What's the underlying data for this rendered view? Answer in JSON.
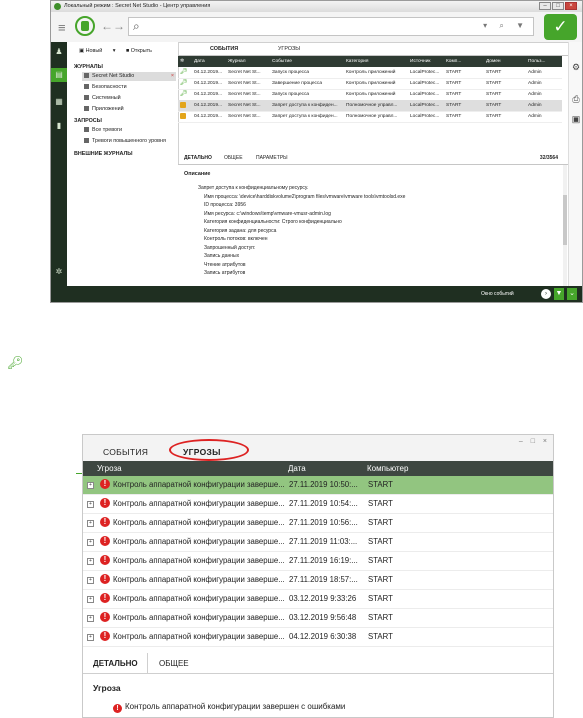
{
  "window": {
    "title": "Локальный режим : Secret Net Studio - Центр управления"
  },
  "tree": {
    "new_button": "Новый",
    "open_button": "Открыть",
    "journals_header": "ЖУРНАЛЫ",
    "journals": [
      "Secret Net Studio",
      "Безопасности",
      "Системный",
      "Приложений"
    ],
    "queries_header": "ЗАПРОСЫ",
    "queries": [
      "Все тревоги",
      "Тревоги повышенного уровня"
    ],
    "external_header": "ВНЕШНИЕ ЖУРНАЛЫ"
  },
  "events": {
    "tabs": [
      "СОБЫТИЯ",
      "УГРОЗЫ"
    ],
    "columns": [
      "Дата",
      "Журнал",
      "Событие",
      "Категория",
      "Источник",
      "Комп...",
      "Домен",
      "Польз..."
    ],
    "rows": [
      {
        "icon": "key",
        "date": "04.12.2019...",
        "journal": "Secret Net St...",
        "event": "Запуск процесса",
        "category": "Контроль приложений",
        "source": "LocalProtec...",
        "computer": "START",
        "domain": "START",
        "user": "Admin"
      },
      {
        "icon": "key",
        "date": "04.12.2019...",
        "journal": "Secret Net St...",
        "event": "Завершение процесса",
        "category": "Контроль приложений",
        "source": "LocalProtec...",
        "computer": "START",
        "domain": "START",
        "user": "Admin"
      },
      {
        "icon": "key",
        "date": "04.12.2019...",
        "journal": "Secret Net St...",
        "event": "Запуск процесса",
        "category": "Контроль приложений",
        "source": "LocalProtec...",
        "computer": "START",
        "domain": "START",
        "user": "Admin"
      },
      {
        "icon": "lock",
        "date": "04.12.2019...",
        "journal": "Secret Net St...",
        "event": "Запрет доступа к конфиден...",
        "category": "Полномочное управл...",
        "source": "LocalProtec...",
        "computer": "START",
        "domain": "START",
        "user": "Admin"
      },
      {
        "icon": "lock",
        "date": "04.12.2019...",
        "journal": "Secret Net St...",
        "event": "Запрет доступа к конфиден...",
        "category": "Полномочное управл...",
        "source": "LocalProtec...",
        "computer": "START",
        "domain": "START",
        "user": "Admin"
      }
    ],
    "detail_tabs": [
      "ДЕТАЛЬНО",
      "ОБЩЕЕ",
      "ПАРАМЕТРЫ"
    ],
    "count": "32/3564",
    "description_header": "Описание",
    "description_lines": [
      "Запрет доступа к конфиденциальному ресурсу.",
      "Имя процесса: \\device\\harddiskvolume2\\program files\\vmware\\vmware tools\\vmtoolsd.exe",
      "ID процесса: 3956",
      "Имя ресурса: c:\\windows\\temp\\vmware-vmusr-admin.log",
      "Категория конфиденциальности: Строго конфиденциально",
      "Категория задана: для ресурса",
      "Контроль потоков: включен",
      "Запрошенный доступ:",
      "Запись данных",
      "Чтение атрибутов",
      "Запись атрибутов"
    ]
  },
  "status": {
    "events_window_label": "Окно событий"
  },
  "threats": {
    "tabs": [
      "СОБЫТИЯ",
      "УГРОЗЫ"
    ],
    "columns": [
      "Угроза",
      "Дата",
      "Компьютер"
    ],
    "rows": [
      {
        "threat": "Контроль аппаратной конфигурации заверше...",
        "date": "27.11.2019 10:50:...",
        "computer": "START"
      },
      {
        "threat": "Контроль аппаратной конфигурации заверше...",
        "date": "27.11.2019 10:54:...",
        "computer": "START"
      },
      {
        "threat": "Контроль аппаратной конфигурации заверше...",
        "date": "27.11.2019 10:56:...",
        "computer": "START"
      },
      {
        "threat": "Контроль аппаратной конфигурации заверше...",
        "date": "27.11.2019 11:03:...",
        "computer": "START"
      },
      {
        "threat": "Контроль аппаратной конфигурации заверше...",
        "date": "27.11.2019 16:19:...",
        "computer": "START"
      },
      {
        "threat": "Контроль аппаратной конфигурации заверше...",
        "date": "27.11.2019 18:57:...",
        "computer": "START"
      },
      {
        "threat": "Контроль аппаратной конфигурации заверше...",
        "date": "03.12.2019 9:33:26",
        "computer": "START"
      },
      {
        "threat": "Контроль аппаратной конфигурации заверше...",
        "date": "03.12.2019 9:56:48",
        "computer": "START"
      },
      {
        "threat": "Контроль аппаратной конфигурации заверше...",
        "date": "04.12.2019 6:30:38",
        "computer": "START"
      }
    ],
    "detail_tabs": [
      "ДЕТАЛЬНО",
      "ОБЩЕЕ"
    ],
    "detail_header": "Угроза",
    "detail_text": "Контроль аппаратной конфигурации завершен с ошибками"
  },
  "colors": {
    "accent": "#46a52b",
    "dark_panel": "#1f2f21",
    "alert_red": "#d22222",
    "selected_row": "#92c580"
  }
}
